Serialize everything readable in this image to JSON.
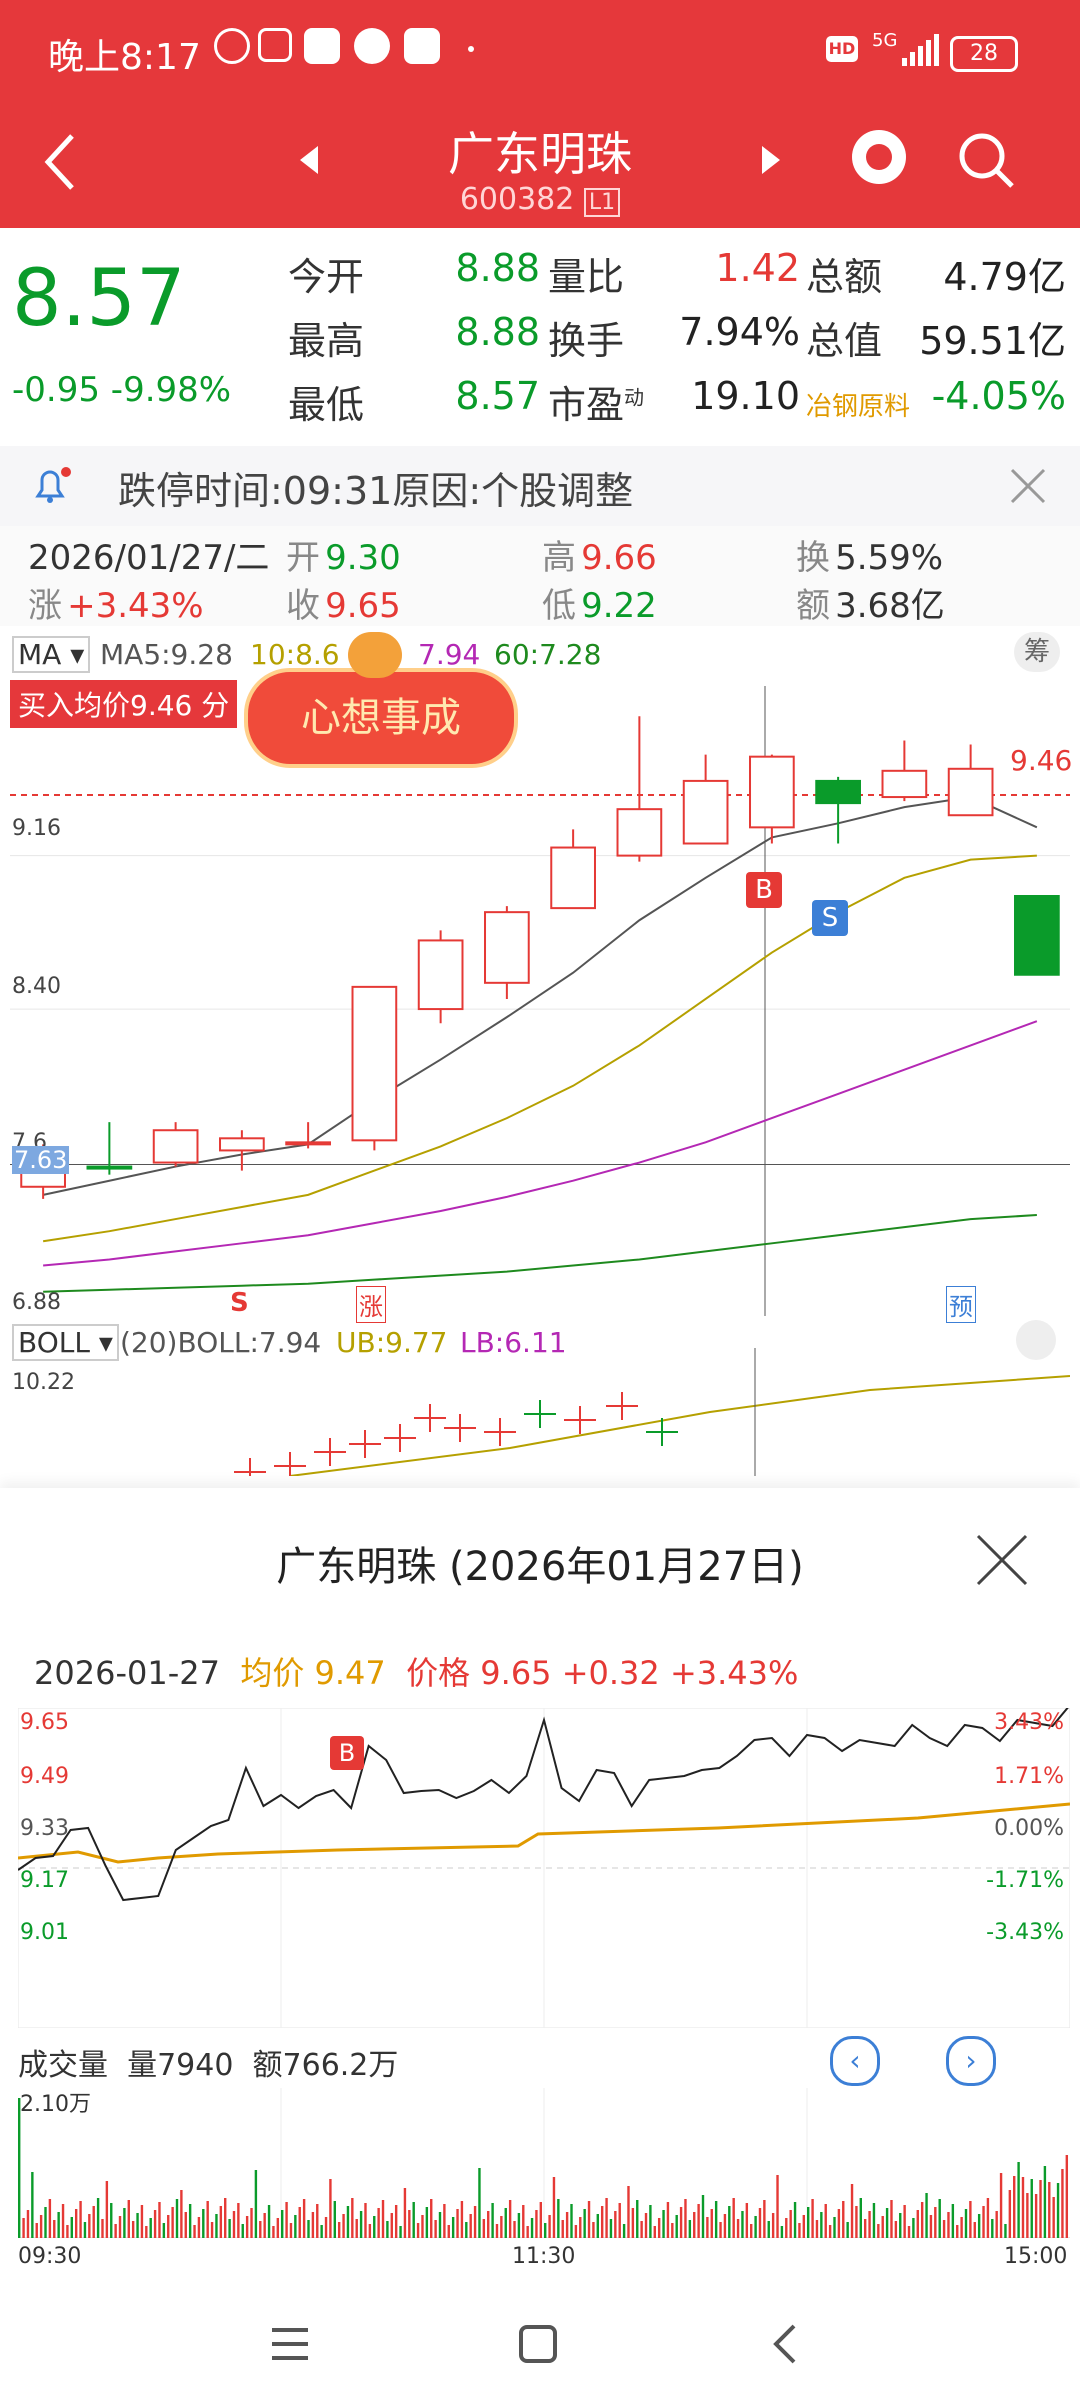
{
  "status": {
    "time": "晚上8:17",
    "battery": "28",
    "net": "5G"
  },
  "header": {
    "title": "广东明珠",
    "code": "600382",
    "level": "L1"
  },
  "quote": {
    "price": "8.57",
    "change": "-0.95",
    "pct": "-9.98%",
    "rows": [
      [
        {
          "l": "今开",
          "v": "8.88",
          "c": "g"
        },
        {
          "l": "量比",
          "v": "1.42",
          "c": "r"
        },
        {
          "l": "总额",
          "v": "4.79亿",
          "c": "k"
        }
      ],
      [
        {
          "l": "最高",
          "v": "8.88",
          "c": "g"
        },
        {
          "l": "换手",
          "v": "7.94%",
          "c": "k"
        },
        {
          "l": "总值",
          "v": "59.51亿",
          "c": "k"
        }
      ],
      [
        {
          "l": "最低",
          "v": "8.57",
          "c": "g"
        },
        {
          "l": "市盈",
          "sup": "动",
          "v": "19.10",
          "c": "k"
        },
        {
          "l": "冶钢原料",
          "v": "-4.05%",
          "c": "g"
        }
      ]
    ]
  },
  "notice": {
    "text": "跌停时间:09:31原因:个股调整"
  },
  "day": {
    "date": "2026/01/27/二",
    "open_l": "开",
    "open": "9.30",
    "high_l": "高",
    "high": "9.66",
    "turn_l": "换",
    "turn": "5.59%",
    "chg_l": "涨",
    "chg": "+3.43%",
    "close_l": "收",
    "close": "9.65",
    "low_l": "低",
    "low": "9.22",
    "amt_l": "额",
    "amt": "3.68亿"
  },
  "ma": {
    "label": "MA",
    "ma5": "MA5:9.28",
    "ma10": "10:8.6",
    "ma30": "7.94",
    "ma60": "60:7.28",
    "chip": "筹"
  },
  "buy_tag": "买入均价9.46 分",
  "sticker": "心想事成",
  "k_axis": {
    "top": "9.16",
    "mid": "8.40",
    "low": "7.6",
    "bot": "6.88",
    "hl": "7.63",
    "buy": "9.46"
  },
  "markers": {
    "s": "S",
    "zhang": "涨",
    "yu": "预",
    "b": "B",
    "s2": "S"
  },
  "boll": {
    "label": "BOLL",
    "params": "(20)",
    "boll": "BOLL:7.94",
    "ub": "UB:9.77",
    "lb": "LB:6.11",
    "top": "10.22"
  },
  "panel": {
    "title": "广东明珠 (2026年01月27日)",
    "date": "2026-01-27",
    "avg_l": "均价",
    "avg": "9.47",
    "price_l": "价格",
    "price": "9.65",
    "chg": "+0.32",
    "pct": "+3.43%",
    "y_left": [
      "9.65",
      "9.49",
      "9.33",
      "9.17",
      "9.01"
    ],
    "y_right": [
      "3.43%",
      "1.71%",
      "0.00%",
      "-1.71%",
      "-3.43%"
    ],
    "b": "B",
    "vol_l": "成交量",
    "vol": "量7940",
    "amt": "额766.2万",
    "vmax": "2.10万",
    "t_start": "09:30",
    "t_mid": "11:30",
    "t_end": "15:00"
  },
  "chart_data": {
    "type": "candlestick",
    "candles": [
      {
        "o": 7.52,
        "c": 7.7,
        "h": 7.73,
        "l": 7.46
      },
      {
        "o": 7.62,
        "c": 7.61,
        "h": 7.84,
        "l": 7.58
      },
      {
        "o": 7.64,
        "c": 7.8,
        "h": 7.84,
        "l": 7.62
      },
      {
        "o": 7.7,
        "c": 7.76,
        "h": 7.8,
        "l": 7.6
      },
      {
        "o": 7.73,
        "c": 7.74,
        "h": 7.84,
        "l": 7.71
      },
      {
        "o": 7.75,
        "c": 8.51,
        "h": 8.51,
        "l": 7.7
      },
      {
        "o": 8.4,
        "c": 8.74,
        "h": 8.79,
        "l": 8.33
      },
      {
        "o": 8.53,
        "c": 8.88,
        "h": 8.91,
        "l": 8.45
      },
      {
        "o": 8.9,
        "c": 9.2,
        "h": 9.29,
        "l": 8.9
      },
      {
        "o": 9.16,
        "c": 9.39,
        "h": 9.85,
        "l": 9.13
      },
      {
        "o": 9.22,
        "c": 9.53,
        "h": 9.66,
        "l": 9.22
      },
      {
        "o": 9.3,
        "c": 9.65,
        "h": 9.66,
        "l": 9.22
      },
      {
        "o": 9.53,
        "c": 9.42,
        "h": 9.55,
        "l": 9.22
      },
      {
        "o": 9.45,
        "c": 9.58,
        "h": 9.73,
        "l": 9.43
      },
      {
        "o": 9.36,
        "c": 9.59,
        "h": 9.71,
        "l": 9.36
      },
      {
        "o": 8.96,
        "c": 8.57,
        "h": 8.96,
        "l": 8.57
      }
    ],
    "ylim": [
      6.88,
      10.0
    ]
  }
}
